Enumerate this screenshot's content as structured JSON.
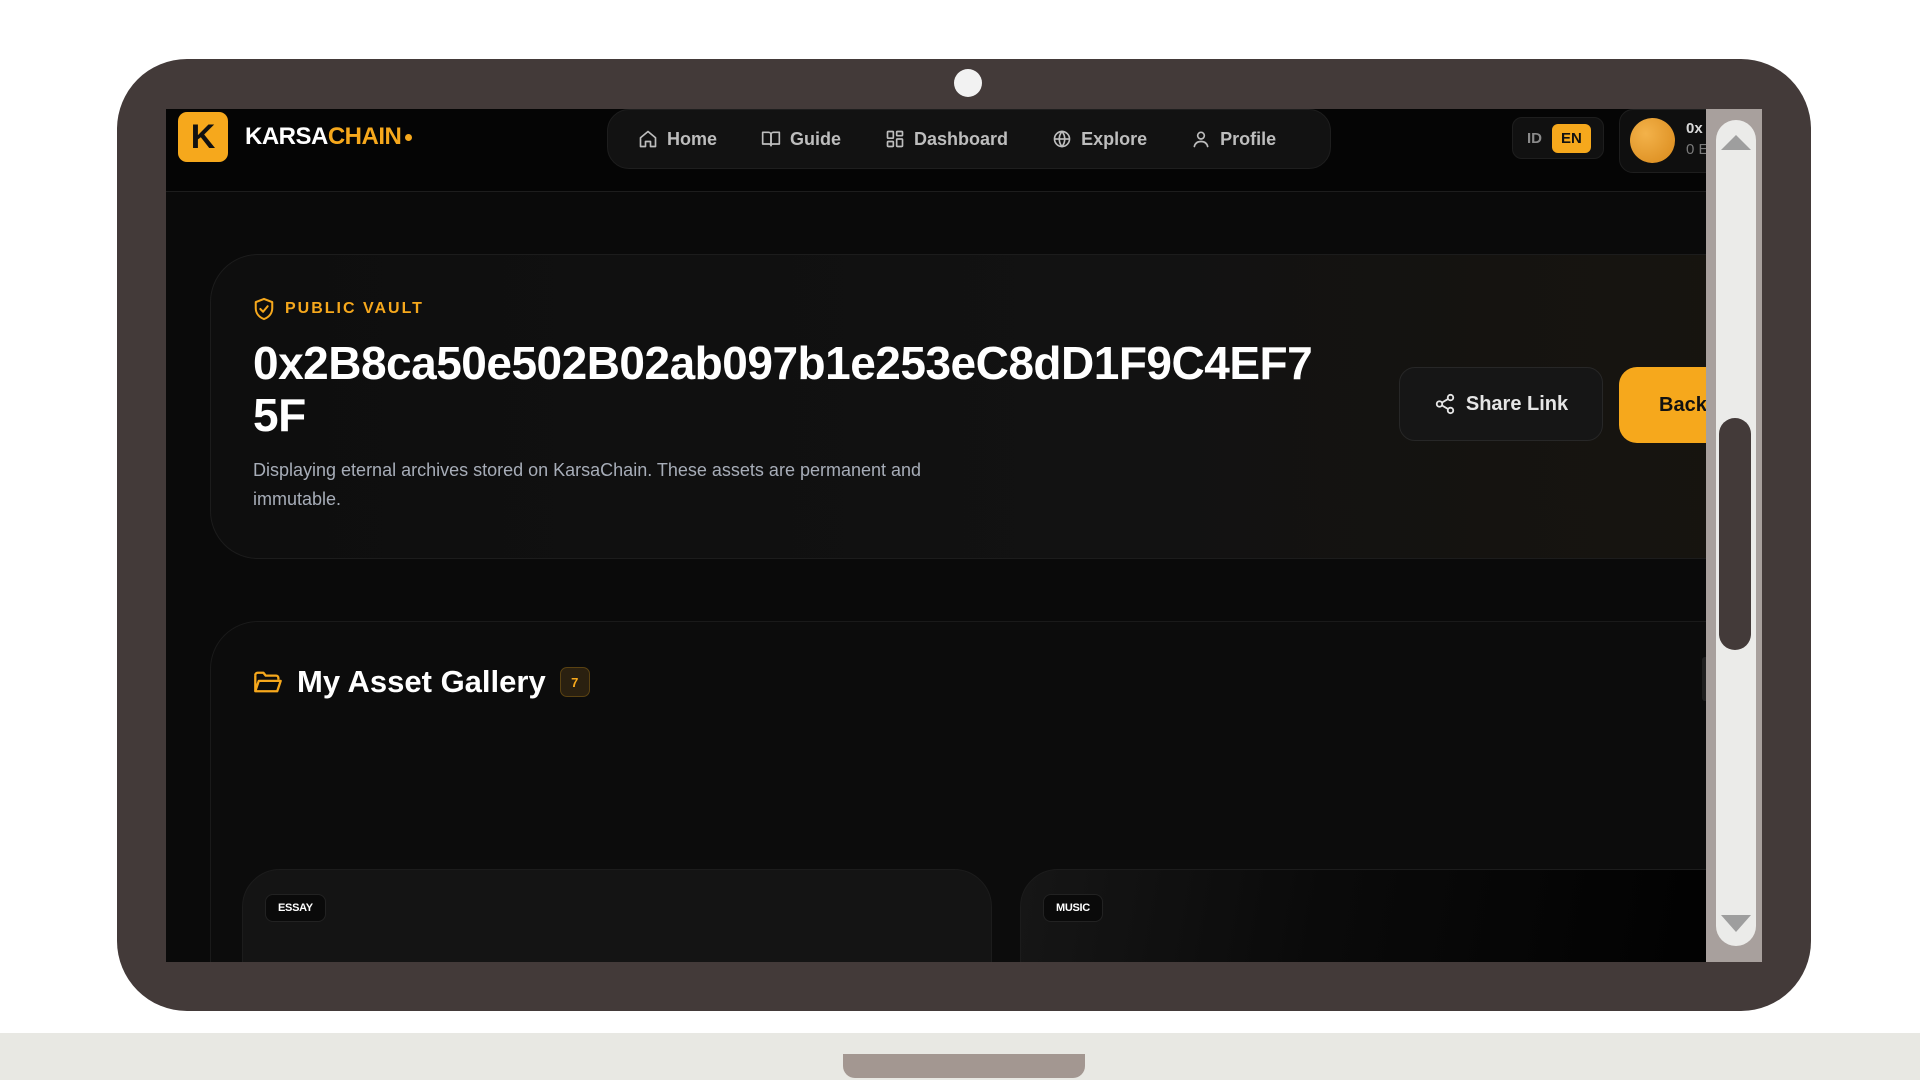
{
  "brand": {
    "logo_letter": "K",
    "name_part1": "KARSA",
    "name_part2": "CHAIN"
  },
  "nav": {
    "items": [
      {
        "label": "Home",
        "icon": "home-icon"
      },
      {
        "label": "Guide",
        "icon": "book-icon"
      },
      {
        "label": "Dashboard",
        "icon": "grid-icon"
      },
      {
        "label": "Explore",
        "icon": "globe-icon"
      },
      {
        "label": "Profile",
        "icon": "user-icon"
      }
    ]
  },
  "language": {
    "option_id": "ID",
    "option_en": "EN",
    "selected": "EN"
  },
  "wallet": {
    "address_short": "0x",
    "balance_short": "0 E"
  },
  "vault": {
    "label": "PUBLIC VAULT",
    "address": "0x2B8ca50e502B02ab097b1e253eC8dD1F9C4EF75F",
    "description": "Displaying eternal archives stored on KarsaChain. These assets are permanent and immutable.",
    "share_label": "Share Link",
    "back_label": "Back to H"
  },
  "gallery": {
    "title": "My Asset Gallery",
    "count": "7",
    "assets": [
      {
        "tag": "ESSAY"
      },
      {
        "tag": "MUSIC"
      }
    ]
  },
  "colors": {
    "accent": "#f6a81c",
    "background": "#0a0a0a",
    "laptop_frame": "#433a39"
  }
}
